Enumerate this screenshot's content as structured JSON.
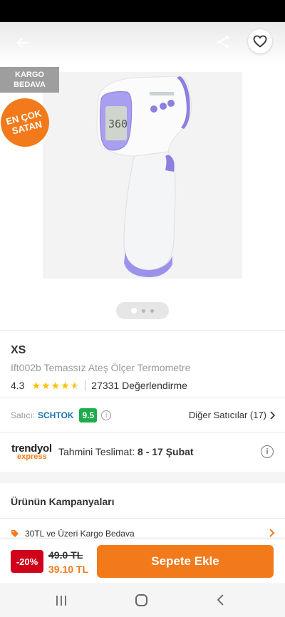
{
  "hero": {
    "kargo_badge": "KARGO\nBEDAVA",
    "bestseller_badge_line1": "EN ÇOK",
    "bestseller_badge_line2": "SATAN",
    "image_dots": {
      "count": 3,
      "active": 0
    }
  },
  "product": {
    "brand": "XS",
    "name": "Ift002b Temassız Ateş Ölçer Termometre",
    "rating": "4.3",
    "rating_value": 4.3,
    "review_count": "27331 Değerlendirme"
  },
  "seller": {
    "label": "Satıcı:",
    "name": "SCHTOK",
    "score": "9.5",
    "other_sellers": "Diğer Satıcılar (17)"
  },
  "delivery": {
    "logo_main": "trendyol",
    "logo_sub": "express",
    "label": "Tahmini Teslimat:",
    "dates": "8 - 17 Şubat"
  },
  "campaigns": {
    "title": "Ürünün Kampanyaları",
    "items": [
      {
        "label": "30TL ve Üzeri Kargo Bedava"
      }
    ]
  },
  "purchase": {
    "discount": "-20%",
    "old_price": "49.0 TL",
    "new_price": "39.10 TL",
    "add_to_cart": "Sepete Ekle"
  },
  "colors": {
    "accent": "#f27a1a",
    "discount": "#d0021b",
    "seller_score": "#1eab4c",
    "link": "#1a73b4",
    "thermometer_accent": "#8b7fe0"
  }
}
